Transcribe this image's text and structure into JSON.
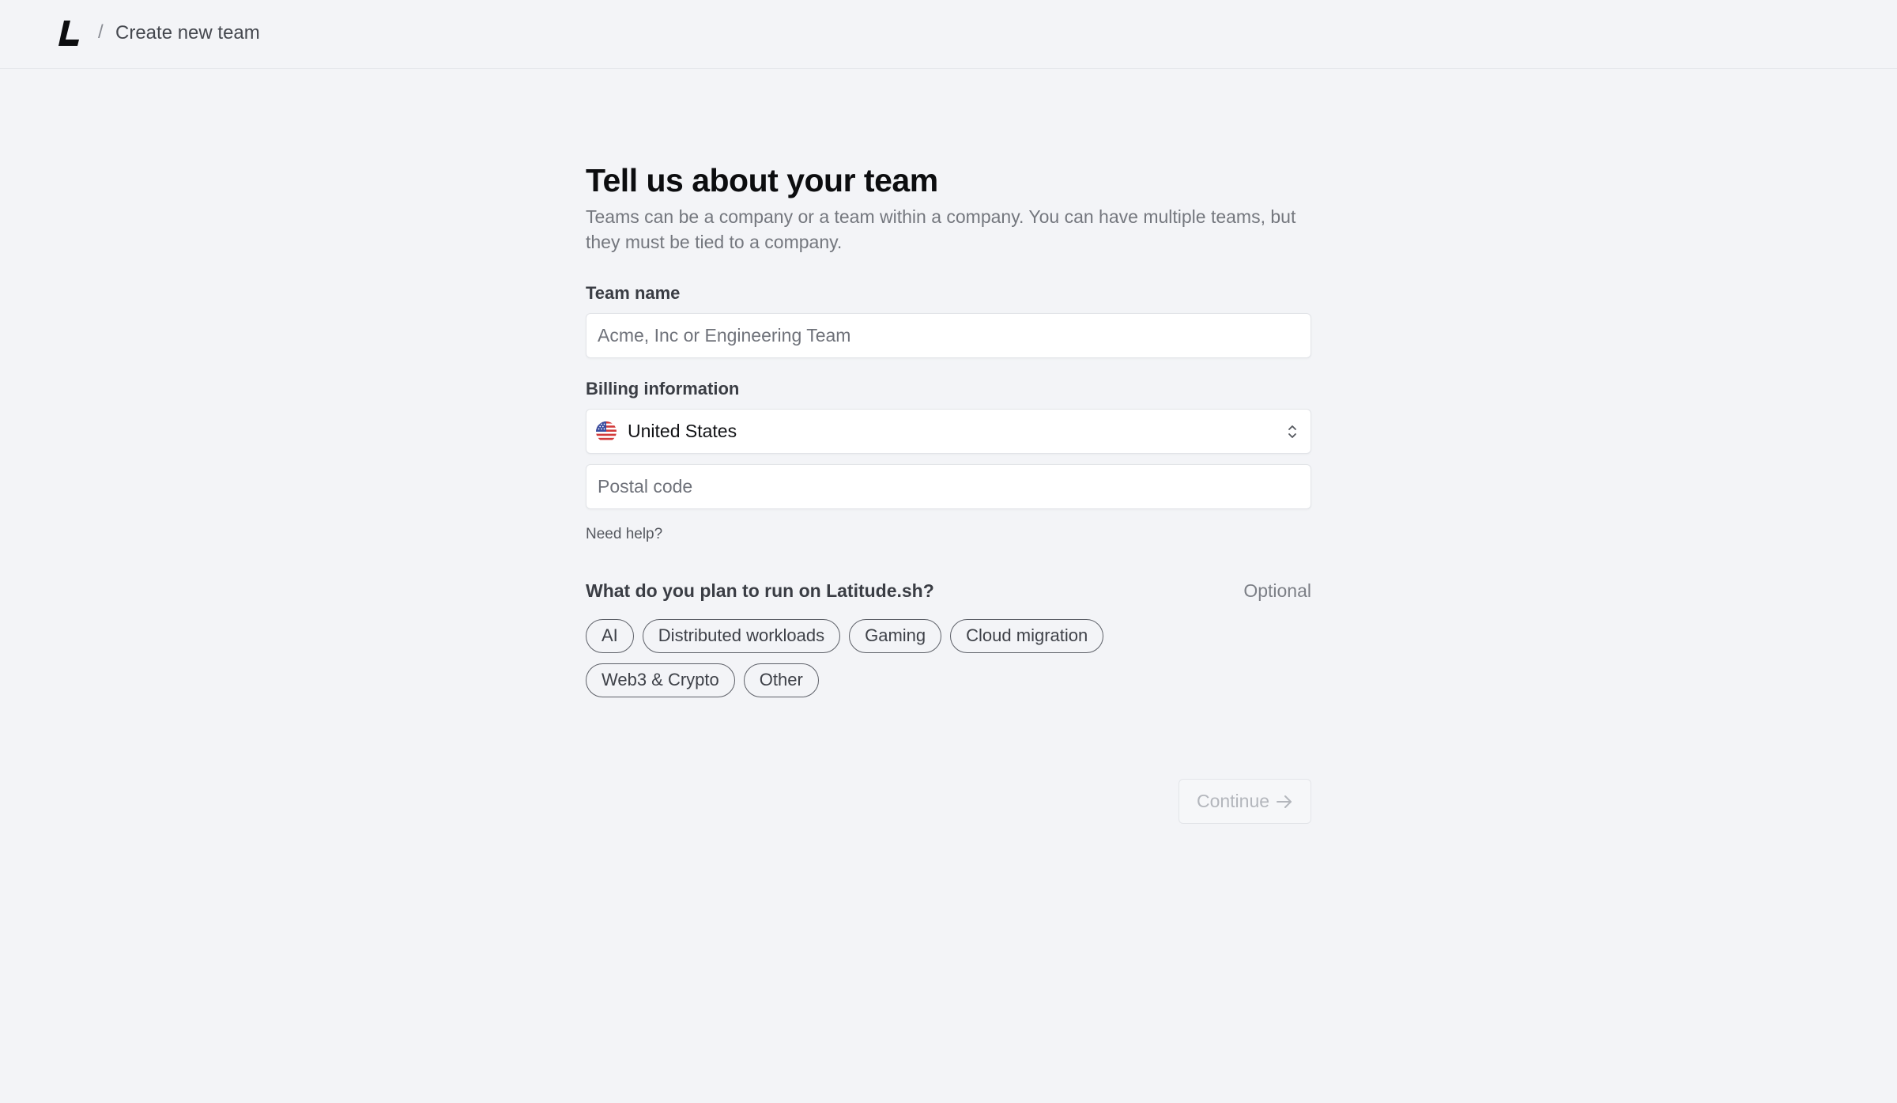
{
  "header": {
    "separator": "/",
    "breadcrumb_title": "Create new team",
    "logo_icon": "latitude-logo-icon"
  },
  "form": {
    "title": "Tell us about your team",
    "subtitle": "Teams can be a company or a team within a company. You can have multiple teams, but they must be tied to a company.",
    "team_name": {
      "label": "Team name",
      "placeholder": "Acme, Inc or Engineering Team",
      "value": ""
    },
    "billing": {
      "label": "Billing information",
      "country": {
        "value": "United States",
        "flag_icon": "us-flag-icon",
        "chevron_icon": "chevron-up-down-icon"
      },
      "postal_code": {
        "placeholder": "Postal code",
        "value": ""
      },
      "help_link": "Need help?"
    },
    "workloads": {
      "label": "What do you plan to run on Latitude.sh?",
      "optional": "Optional",
      "options_row1": [
        "AI",
        "Distributed workloads",
        "Gaming",
        "Cloud migration"
      ],
      "options_row2": [
        "Web3 & Crypto",
        "Other"
      ]
    },
    "continue_button": {
      "label": "Continue",
      "icon": "arrow-right-icon",
      "disabled": true
    }
  },
  "colors": {
    "background": "#f3f4f7",
    "title": "#0c0d0f",
    "muted_text": "#74777e",
    "input_border": "#e2e4e8",
    "chip_border": "#5d6068",
    "disabled_text": "#b3b6bc"
  }
}
